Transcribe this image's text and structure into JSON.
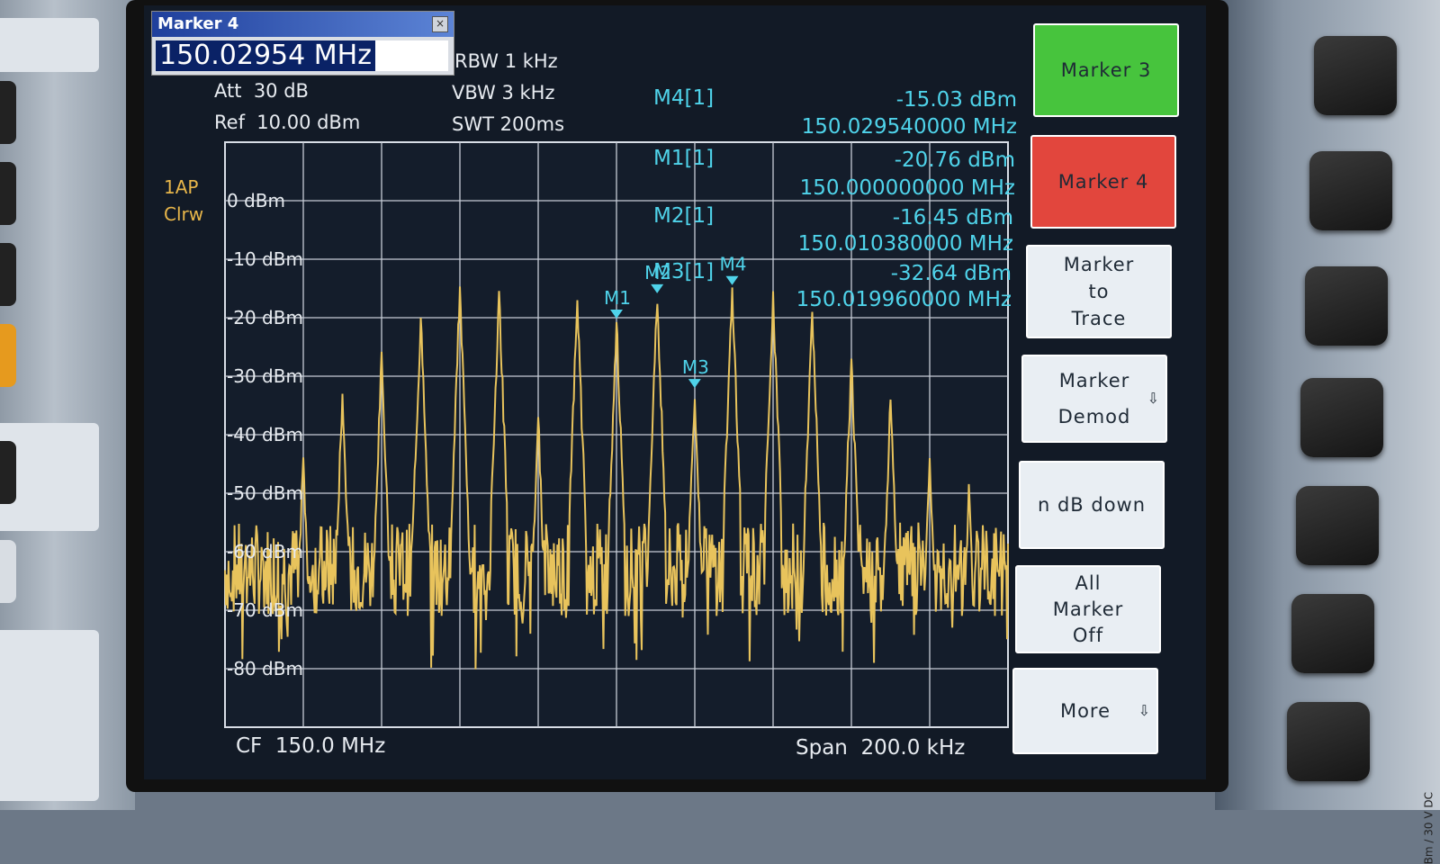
{
  "dialog": {
    "title": "Marker 4",
    "value": "150.02954 MHz"
  },
  "settings": {
    "rbw": "RBW 1 kHz",
    "vbw": "VBW 3 kHz",
    "swt": "SWT 200ms",
    "att": "Att  30 dB",
    "ref": "Ref  10.00 dBm"
  },
  "trace": {
    "line1": "1AP",
    "line2": "Clrw"
  },
  "marker_readouts": [
    {
      "name": "M4[1]",
      "level": "-15.03 dBm",
      "freq": "150.029540000 MHz"
    },
    {
      "name": "M1[1]",
      "level": "-20.76 dBm",
      "freq": "150.000000000 MHz"
    },
    {
      "name": "M2[1]",
      "level": "-16.45 dBm",
      "freq": "150.010380000 MHz"
    },
    {
      "name": "M3[1]",
      "level": "-32.64 dBm",
      "freq": "150.019960000 MHz"
    }
  ],
  "chart_data": {
    "type": "line",
    "y_tick_labels": [
      "0 dBm",
      "-10 dBm",
      "-20 dBm",
      "-30 dBm",
      "-40 dBm",
      "-50 dBm",
      "-60 dBm",
      "-70 dBm",
      "-80 dBm"
    ],
    "ylim": [
      -90,
      10
    ],
    "xlim_khz": [
      -100,
      100
    ],
    "grid": true,
    "trace_color": "#e8c35c",
    "peaks": [
      {
        "offset_khz": -80,
        "level_dbm": -44
      },
      {
        "offset_khz": -70,
        "level_dbm": -33
      },
      {
        "offset_khz": -60,
        "level_dbm": -27
      },
      {
        "offset_khz": -50,
        "level_dbm": -20
      },
      {
        "offset_khz": -40,
        "level_dbm": -15
      },
      {
        "offset_khz": -30,
        "level_dbm": -16
      },
      {
        "offset_khz": -20,
        "level_dbm": -37
      },
      {
        "offset_khz": -10,
        "level_dbm": -17
      },
      {
        "offset_khz": 0,
        "level_dbm": -20.76
      },
      {
        "offset_khz": 10.38,
        "level_dbm": -16.45
      },
      {
        "offset_khz": 19.96,
        "level_dbm": -32.64
      },
      {
        "offset_khz": 29.54,
        "level_dbm": -15.03
      },
      {
        "offset_khz": 40,
        "level_dbm": -16
      },
      {
        "offset_khz": 50,
        "level_dbm": -19
      },
      {
        "offset_khz": 60,
        "level_dbm": -27
      },
      {
        "offset_khz": 70,
        "level_dbm": -34
      },
      {
        "offset_khz": 80,
        "level_dbm": -44
      },
      {
        "offset_khz": 90,
        "level_dbm": -50
      }
    ],
    "noise_floor_dbm": -63,
    "markers": [
      {
        "label": "M1",
        "offset_khz": 0,
        "level_dbm": -20.76
      },
      {
        "label": "M2",
        "offset_khz": 10.38,
        "level_dbm": -16.45
      },
      {
        "label": "M3",
        "offset_khz": 19.96,
        "level_dbm": -32.64
      },
      {
        "label": "M4",
        "offset_khz": 29.54,
        "level_dbm": -15.03
      }
    ],
    "marker_color": "#4fd3ea"
  },
  "footer": {
    "cf": "CF  150.0 MHz",
    "span": "Span  200.0 kHz"
  },
  "softkeys": [
    {
      "label": "Marker 3",
      "style": "green"
    },
    {
      "label": "Marker 4",
      "style": "red"
    },
    {
      "label": "Marker\nto\nTrace",
      "style": "white"
    },
    {
      "label": "Marker\nDemod",
      "style": "white",
      "arrow": "⇩"
    },
    {
      "label": "n dB down",
      "style": "white"
    },
    {
      "label": "All\nMarker\nOff",
      "style": "white"
    },
    {
      "label": "More",
      "style": "white",
      "arrow": "⇩"
    }
  ],
  "bezel_label": "Bm / 30 V DC"
}
